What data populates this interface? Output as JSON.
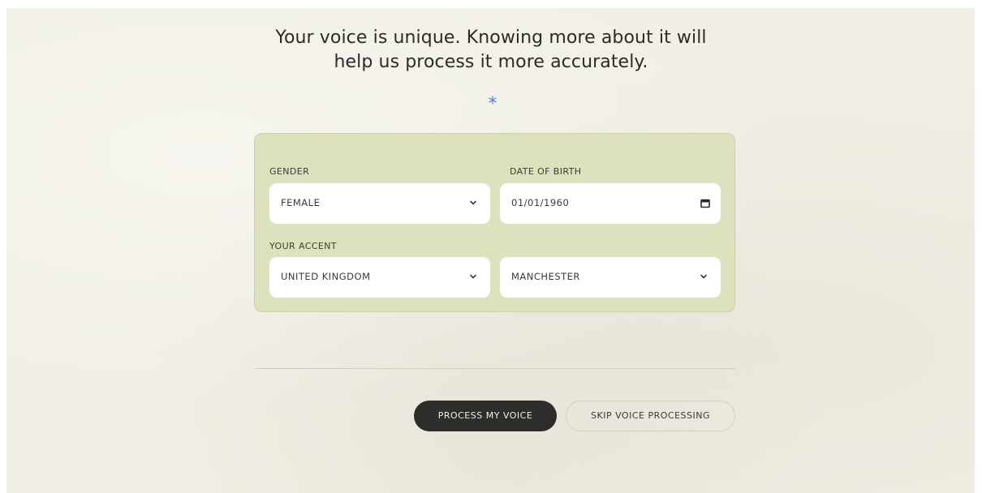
{
  "headline": {
    "line1": "Your voice is unique. Knowing more about it will",
    "line2": "help us process it more accurately."
  },
  "decoration": {
    "asterisk": "*",
    "asterisk_color": "#5b7be0"
  },
  "form": {
    "background": "#dde1bd",
    "gender": {
      "label": "GENDER",
      "value": "FEMALE",
      "icon": "chevron-down-icon"
    },
    "date_of_birth": {
      "label": "DATE OF BIRTH",
      "value": "01/01/1960",
      "icon": "calendar-icon"
    },
    "accent": {
      "label": "YOUR ACCENT",
      "country": "UNITED KINGDOM",
      "region": "MANCHESTER",
      "icon": "chevron-down-icon"
    }
  },
  "actions": {
    "process_label": "PROCESS MY VOICE",
    "skip_label": "SKIP VOICE PROCESSING",
    "primary_color": "#2e2d2b"
  }
}
